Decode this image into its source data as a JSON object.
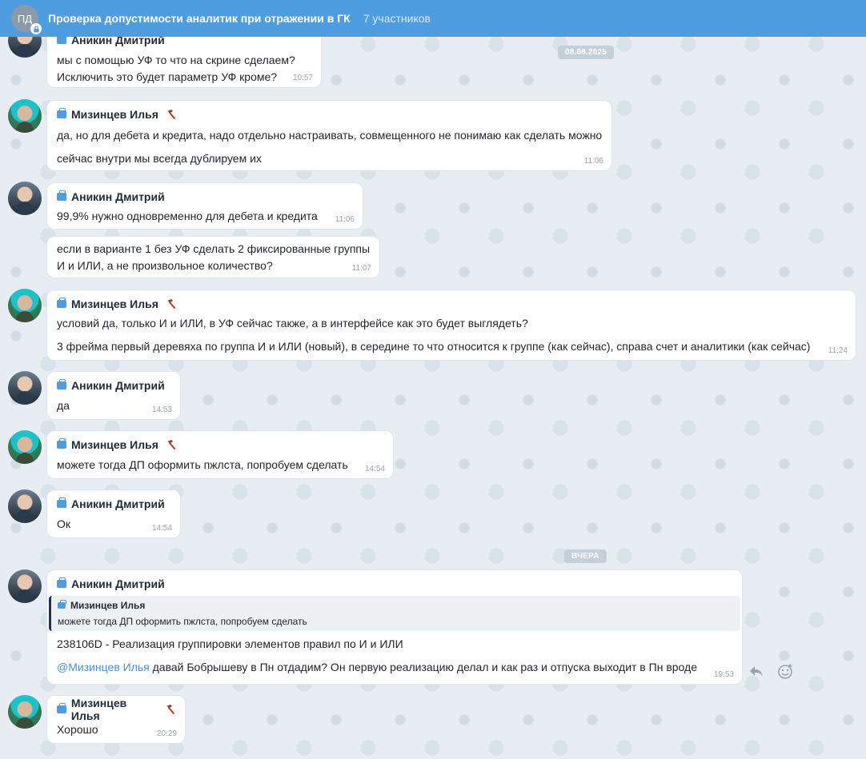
{
  "header": {
    "avatar_initials": "ПД",
    "title": "Проверка допустимости аналитик при отражении в ГК",
    "members": "7 участников",
    "color": "#4d9de0"
  },
  "dates": {
    "first": "08.08.2025",
    "second": "ВЧЕРА"
  },
  "messages": [
    {
      "sender": "Аникин Дмитрий",
      "lines": [
        "мы с помощью УФ то что на скрине сделаем?",
        "Исключить это будет параметр УФ кроме?"
      ],
      "time": "10:57"
    },
    {
      "sender": "Мизинцев Илья",
      "lines": [
        "да, но для дебета и кредита, надо отдельно настраивать, совмещенного не понимаю как сделать можно",
        "сейчас внутри мы всегда дублируем их"
      ],
      "time": "11:06"
    },
    {
      "sender": "Аникин Дмитрий",
      "lines": [
        "99,9% нужно одновременно для дебета и кредита"
      ],
      "time": "11:06"
    },
    {
      "sender": "",
      "lines": [
        "если в варианте 1 без УФ сделать 2 фиксированные группы",
        "И и ИЛИ, а не произвольное количество?"
      ],
      "time": "11:07"
    },
    {
      "sender": "Мизинцев Илья",
      "lines": [
        "условий да, только И и ИЛИ, в УФ сейчас также, а в интерфейсе как это будет выглядеть?",
        "3 фрейма первый деревяха по группа И и ИЛИ (новый), в середине то что относится к группе (как сейчас), справа счет и аналитики (как сейчас)"
      ],
      "time": "11:24"
    },
    {
      "sender": "Аникин Дмитрий",
      "lines": [
        "да"
      ],
      "time": "14:53"
    },
    {
      "sender": "Мизинцев Илья",
      "lines": [
        "можете тогда ДП оформить пжлста, попробуем сделать"
      ],
      "time": "14:54"
    },
    {
      "sender": "Аникин Дмитрий",
      "lines": [
        "Ок"
      ],
      "time": "14:54"
    },
    {
      "sender": "Аникин Дмитрий",
      "quote": {
        "sender": "Мизинцев Илья",
        "text": "можете тогда ДП оформить пжлста, попробуем сделать"
      },
      "lines": [
        "238106D - Реализация группировки элементов правил по И и ИЛИ"
      ],
      "mention": "@Мизинцев Илья",
      "mention_rest": " давай Бобрышеву в Пн отдадим? Он первую реализацию делал и как раз и отпуска выходит в Пн вроде",
      "time": "19:53"
    },
    {
      "sender": "Мизинцев Илья",
      "lines": [
        "Хорошо"
      ],
      "time": "20:29"
    }
  ]
}
